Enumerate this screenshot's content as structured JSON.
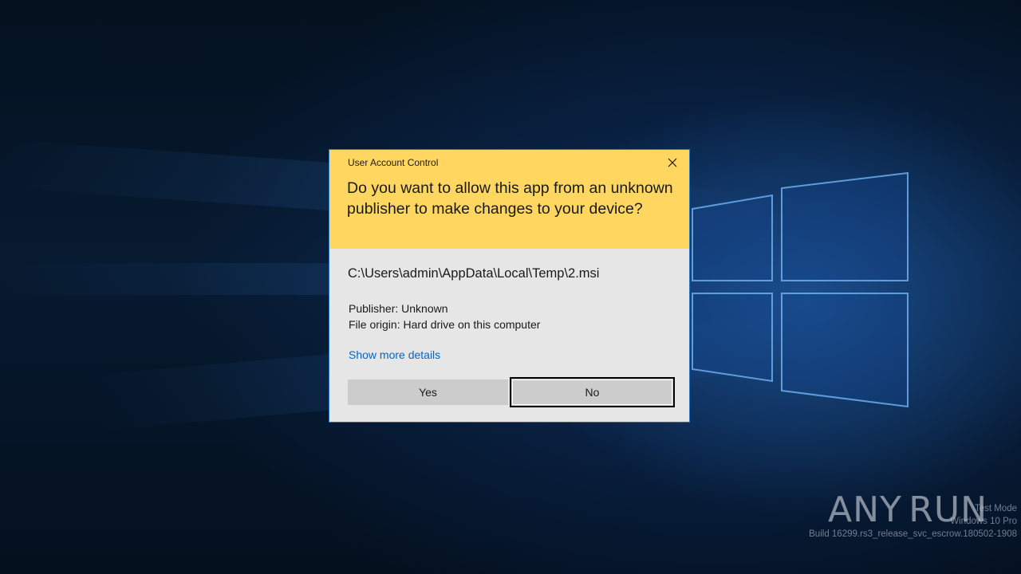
{
  "dialog": {
    "title": "User Account Control",
    "question": "Do you want to allow this app from an unknown publisher to make changes to your device?",
    "path": "C:\\Users\\admin\\AppData\\Local\\Temp\\2.msi",
    "publisher": "Publisher: Unknown",
    "file_origin": "File origin: Hard drive on this computer",
    "more_details": "Show more details",
    "yes_label": "Yes",
    "no_label": "No",
    "close_icon": "close-icon"
  },
  "desktop": {
    "watermark_mode": "Test Mode",
    "watermark_edition": "Windows 10 Pro",
    "watermark_build": "Build 16299.rs3_release_svc_escrow.180502-1908",
    "logo_left": "ANY",
    "logo_right": "RUN"
  },
  "colors": {
    "dialog_header": "#fed660",
    "dialog_body": "#e6e6e6",
    "link": "#0066cc",
    "button": "#cccccc",
    "dialog_border": "#2b79c4"
  }
}
